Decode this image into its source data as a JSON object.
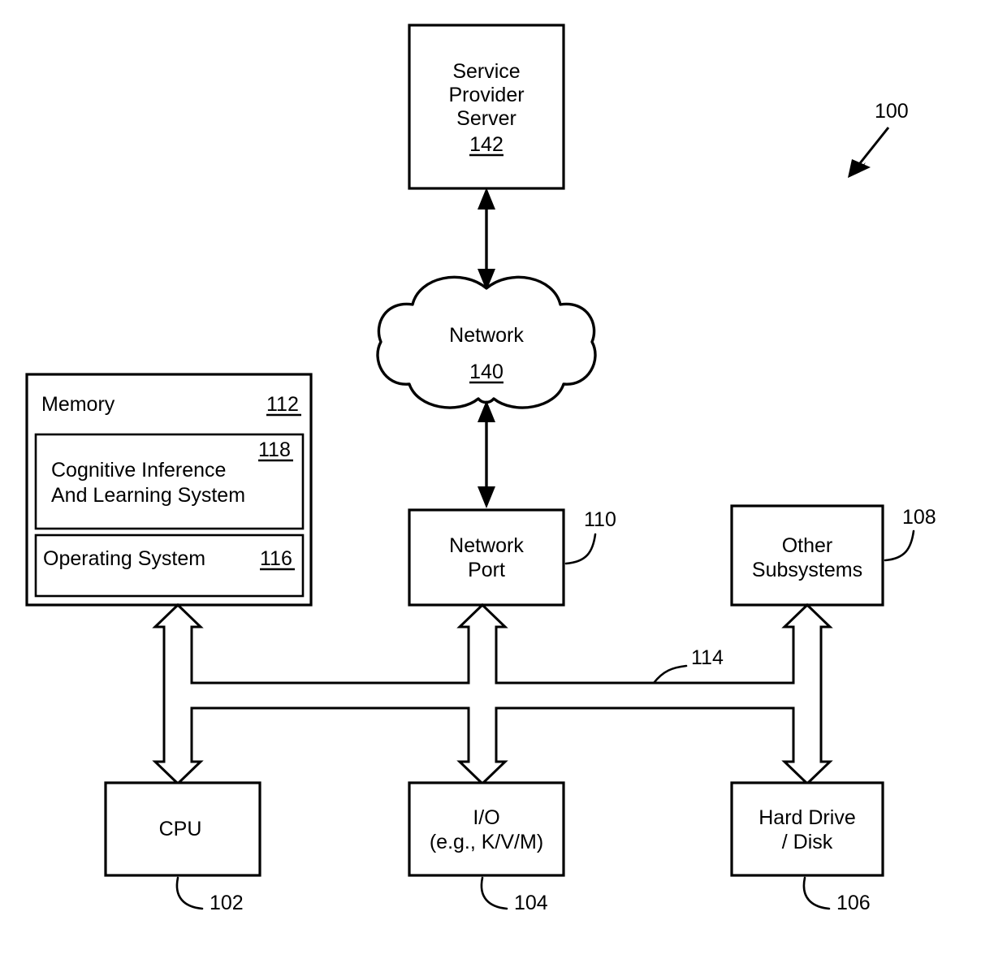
{
  "figure": {
    "reference_label": "100",
    "blocks": {
      "service_provider_server": {
        "line1": "Service",
        "line2": "Provider",
        "line3": "Server",
        "ref": "142"
      },
      "network": {
        "label": "Network",
        "ref": "140"
      },
      "memory": {
        "label": "Memory",
        "ref": "112"
      },
      "cognitive_system": {
        "line1": "Cognitive Inference",
        "line2": "And Learning System",
        "ref": "118"
      },
      "operating_system": {
        "label": "Operating System",
        "ref": "116"
      },
      "network_port": {
        "line1": "Network",
        "line2": "Port",
        "ref": "110"
      },
      "other_subsystems": {
        "line1": "Other",
        "line2": "Subsystems",
        "ref": "108"
      },
      "cpu": {
        "label": "CPU",
        "ref": "102"
      },
      "io": {
        "line1": "I/O",
        "line2": "(e.g., K/V/M)",
        "ref": "104"
      },
      "hard_drive": {
        "line1": "Hard Drive",
        "line2": "/ Disk",
        "ref": "106"
      },
      "bus": {
        "ref": "114"
      }
    },
    "colors": {
      "stroke": "#000000",
      "fill": "#ffffff",
      "background": "#ffffff"
    }
  }
}
